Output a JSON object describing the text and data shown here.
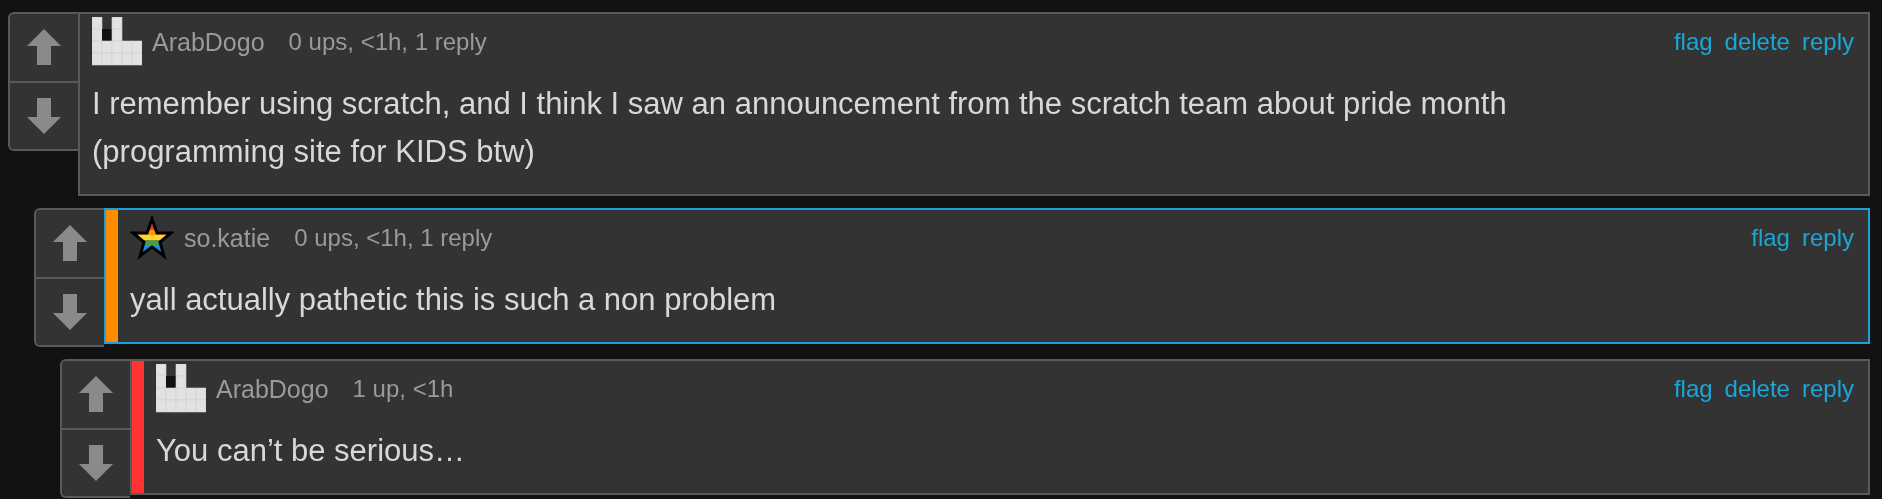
{
  "comments": [
    {
      "author": "ArabDogo",
      "kind": "blocks",
      "meta": "0 ups, <1h, 1 reply",
      "actions": [
        "flag",
        "delete",
        "reply"
      ],
      "body": "I remember using scratch, and I think I saw an announcement from the scratch team about pride month\n(programming site for KIDS btw)",
      "highlighted": false,
      "children": [
        {
          "author": "so.katie",
          "kind": "star",
          "meta": "0 ups, <1h, 1 reply",
          "actions": [
            "flag",
            "reply"
          ],
          "body": "yall actually pathetic this is such a non problem",
          "color": "#ff8c00",
          "highlighted": true,
          "children": [
            {
              "author": "ArabDogo",
              "kind": "blocks",
              "meta": "1 up, <1h",
              "actions": [
                "flag",
                "delete",
                "reply"
              ],
              "body": "You can’t be serious…",
              "color": "#ff3333",
              "highlighted": false
            }
          ]
        }
      ]
    }
  ]
}
